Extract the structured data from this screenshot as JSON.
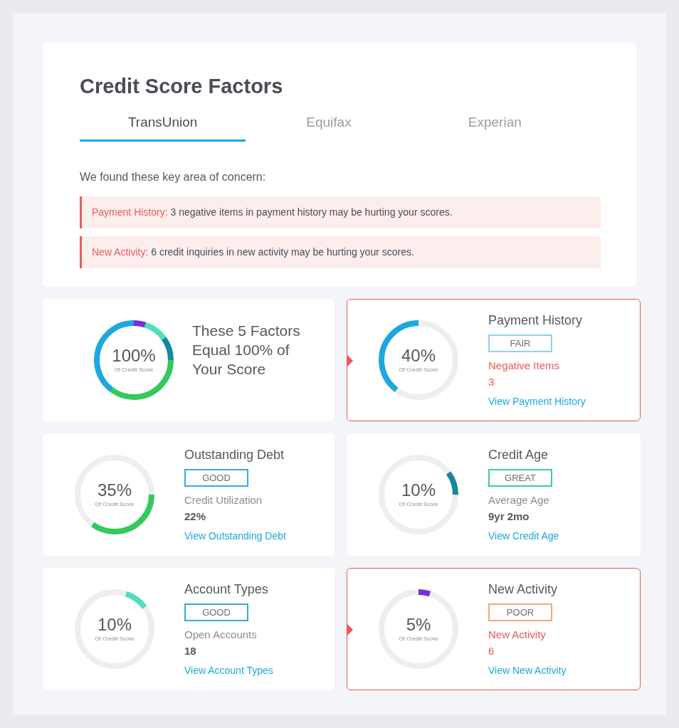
{
  "title": "Credit Score Factors",
  "tabs": [
    {
      "label": "TransUnion",
      "selected": true
    },
    {
      "label": "Equifax",
      "selected": false
    },
    {
      "label": "Experian",
      "selected": false
    }
  ],
  "concern_intro": "We found these key area of concern:",
  "concerns": [
    {
      "label": "Payment History:",
      "text": "3 negative items in payment history may be hurting your scores."
    },
    {
      "label": "New Activity:",
      "text": "6 credit inquiries in new activity may be hurting your scores."
    }
  ],
  "summary": {
    "percent": "100%",
    "caption": "Of Credit Score",
    "heading": "These 5 Factors Equal 100% of Your Score"
  },
  "factors": [
    {
      "title": "Payment History",
      "percent": "40%",
      "caption": "Of Credit Score",
      "level": 0.4,
      "color": "#1ca7e0",
      "badge": {
        "text": "FAIR",
        "color": "#8fd0ee"
      },
      "stat_label": "Negative Items",
      "stat_value": "3",
      "link": "View Payment History",
      "alert": true
    },
    {
      "title": "Outstanding Debt",
      "percent": "35%",
      "caption": "Of Credit Score",
      "level": 0.35,
      "color": "#34c95c",
      "badge": {
        "text": "GOOD",
        "color": "#3aa8e0"
      },
      "stat_label": "Credit Utilization",
      "stat_value": "22%",
      "link": "View Outstanding Debt",
      "alert": false
    },
    {
      "title": "Credit Age",
      "percent": "10%",
      "caption": "Of Credit Score",
      "level": 0.1,
      "color": "#16899e",
      "badge": {
        "text": "GREAT",
        "color": "#40c9a6"
      },
      "stat_label": "Average Age",
      "stat_value": "9yr 2mo",
      "link": "View Credit Age",
      "alert": false
    },
    {
      "title": "Account Types",
      "percent": "10%",
      "caption": "Of Credit Score",
      "level": 0.1,
      "color": "#4fe0c0",
      "badge": {
        "text": "GOOD",
        "color": "#3aa8e0"
      },
      "stat_label": "Open Accounts",
      "stat_value": "18",
      "link": "View Account Types",
      "alert": false
    },
    {
      "title": "New Activity",
      "percent": "5%",
      "caption": "Of Credit Score",
      "level": 0.05,
      "color": "#7a2fd6",
      "badge": {
        "text": "POOR",
        "color": "#f2a77a"
      },
      "stat_label": "New Activity",
      "stat_value": "6",
      "link": "View New Activity",
      "alert": true
    }
  ]
}
